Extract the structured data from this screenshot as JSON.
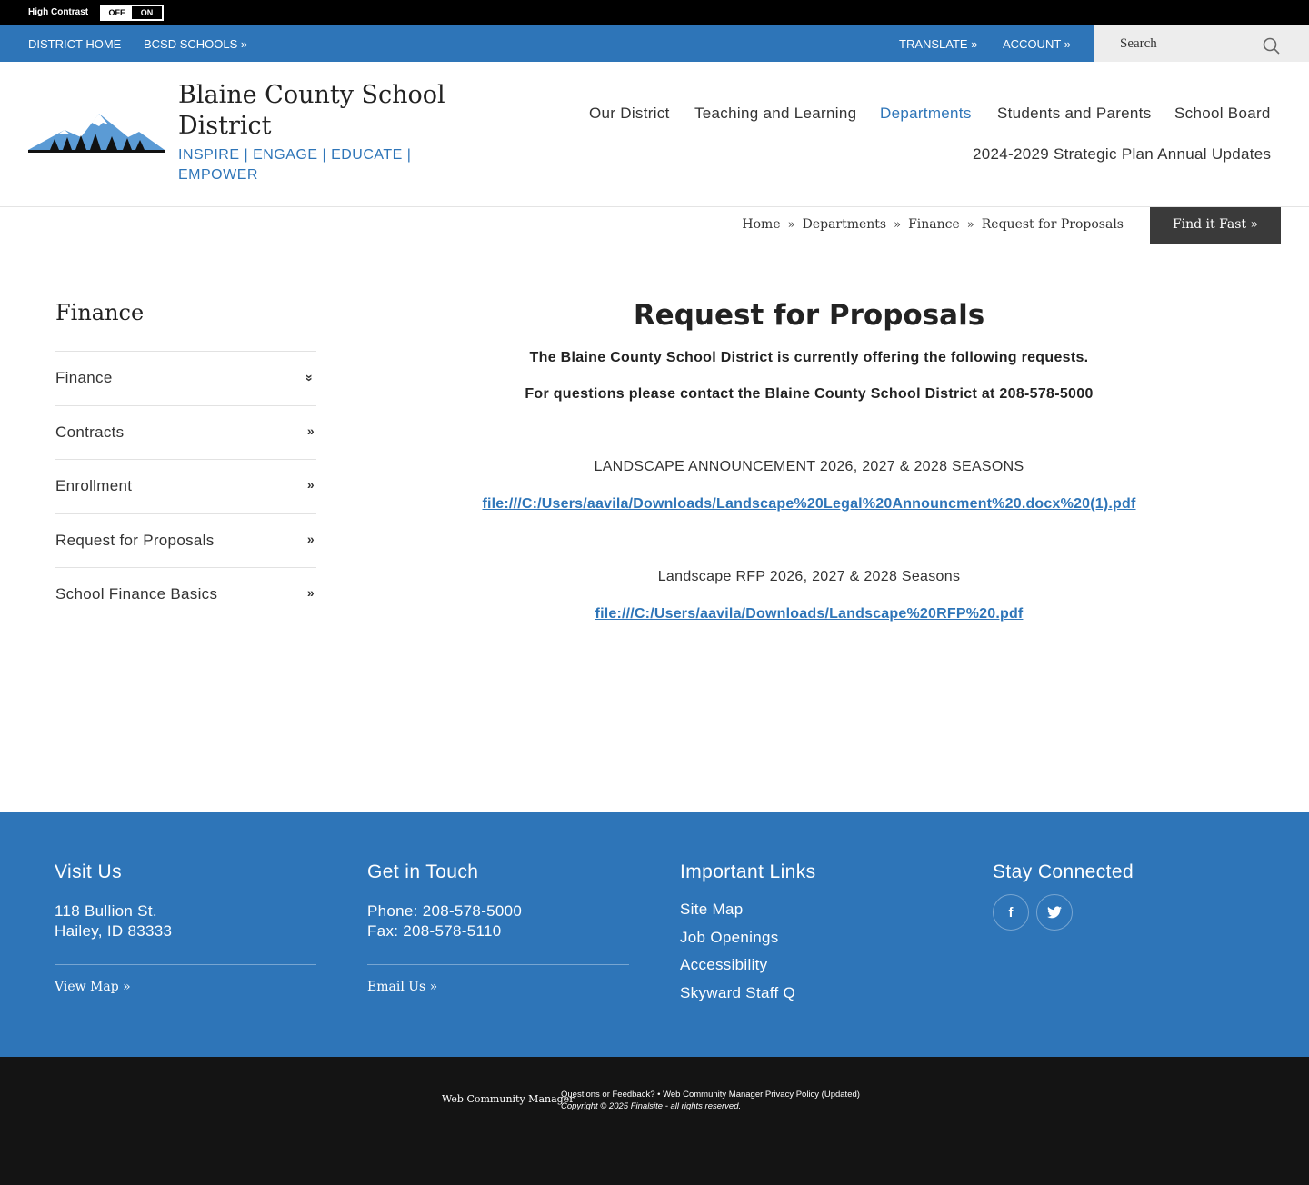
{
  "contrast": {
    "label": "High Contrast",
    "off": "OFF",
    "on": "ON"
  },
  "utility": {
    "district_home": "DISTRICT HOME",
    "bcsd_schools": "BCSD SCHOOLS »",
    "translate": "TRANSLATE »",
    "account": "ACCOUNT »",
    "search_placeholder": "Search"
  },
  "header": {
    "site_name": "Blaine County School District",
    "tagline": "INSPIRE | ENGAGE | EDUCATE | EMPOWER"
  },
  "main_nav": [
    "Our District",
    "Teaching and Learning",
    "Departments",
    "Students and Parents",
    "School Board",
    "2024-2029 Strategic Plan Annual Updates"
  ],
  "breadcrumb": [
    "Home",
    "Departments",
    "Finance",
    "Request for Proposals"
  ],
  "breadcrumb_sep": "»",
  "find_it_fast": "Find it Fast »",
  "sidebar": {
    "title": "Finance",
    "items": [
      {
        "label": "Finance",
        "chev": "»"
      },
      {
        "label": "Contracts",
        "chev": "»"
      },
      {
        "label": "Enrollment",
        "chev": "»"
      },
      {
        "label": "Request for Proposals",
        "chev": "»"
      },
      {
        "label": "School Finance Basics",
        "chev": "»"
      }
    ]
  },
  "content": {
    "title": "Request for Proposals",
    "intro1": "The Blaine County School District is currently offering the following requests.",
    "intro2": "For questions please contact the Blaine County School District at 208-578-5000",
    "item1_title": "LANDSCAPE ANNOUNCEMENT  2026, 2027 & 2028 SEASONS",
    "item1_link": "file:///C:/Users/aavila/Downloads/Landscape%20Legal%20Announcment%20.docx%20(1).pdf",
    "item2_title": "Landscape RFP 2026, 2027 & 2028 Seasons",
    "item2_link": "file:///C:/Users/aavila/Downloads/Landscape%20RFP%20.pdf"
  },
  "footer": {
    "visit_head": "Visit Us",
    "address1": "118 Bullion St.",
    "address2": "Hailey, ID 83333",
    "view_map": "View Map »",
    "touch_head": "Get in Touch",
    "phone": "Phone: 208-578-5000",
    "fax": "Fax: 208-578-5110",
    "email": "Email Us »",
    "links_head": "Important Links",
    "links": [
      "Site Map",
      "Job Openings",
      "Accessibility",
      "Skyward Staff Q"
    ],
    "connect_head": "Stay Connected",
    "facebook": "f",
    "twitter": "t"
  },
  "bottom": {
    "wcm": "Web Community Manager",
    "feedback": "Questions or Feedback? • Web Community Manager Privacy Policy (Updated)",
    "copyright": "Copyright © 2025 Finalsite - all rights reserved."
  }
}
